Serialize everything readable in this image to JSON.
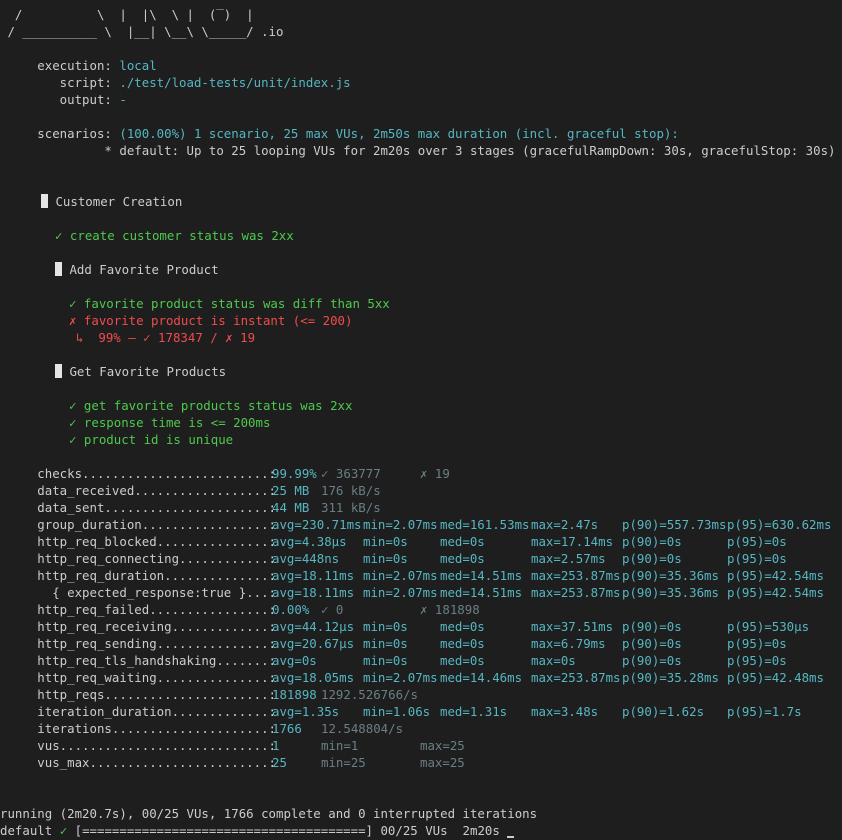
{
  "logo": {
    "line1": "  /          \\  |  |\\  \\ |  (‾)  |",
    "line2": " / __________ \\  |__| \\__\\ \\_____/ .io"
  },
  "options": [
    {
      "label": "     execution: ",
      "value": "local"
    },
    {
      "label": "        script: ",
      "value": "./test/load-tests/unit/index.js"
    },
    {
      "label": "        output: ",
      "value": "-"
    }
  ],
  "scenarios": {
    "label": "     scenarios: ",
    "summary": "(100.00%) 1 scenario, 25 max VUs, 2m50s max duration (incl. graceful stop):",
    "detail": "              * default: Up to 25 looping VUs for 2m20s over 3 stages (gracefulRampDown: 30s, gracefulStop: 30s)"
  },
  "groups": {
    "customer_creation": "Customer Creation",
    "add_favorite": "Add Favorite Product",
    "get_favorites": "Get Favorite Products"
  },
  "checks_list": {
    "create_status": "✓ create customer status was 2xx",
    "fav_status": "✓ favorite product status was diff than 5xx",
    "fav_instant": "✗ favorite product is instant (<= 200)",
    "fav_instant_detail": "↳  99% — ✓ 178347 / ✗ 19",
    "get_status": "✓ get favorite products status was 2xx",
    "response_time": "✓ response time is <= 200ms",
    "product_id": "✓ product id is unique"
  },
  "metrics": [
    {
      "name": "     checks.........................: ",
      "cols": [
        {
          "t": "99.99%",
          "k": "c"
        },
        {
          "t": "✓ 363777",
          "k": "dim"
        },
        {
          "t": "✗ 19",
          "k": "dim"
        }
      ]
    },
    {
      "name": "     data_received..................: ",
      "cols": [
        {
          "t": "25 MB",
          "k": "c"
        },
        {
          "t": "176 kB/s",
          "k": "dim"
        }
      ]
    },
    {
      "name": "     data_sent......................: ",
      "cols": [
        {
          "t": "44 MB",
          "k": "c"
        },
        {
          "t": "311 kB/s",
          "k": "dim"
        }
      ]
    },
    {
      "name": "     group_duration.................: ",
      "cols": [
        {
          "t": "avg=230.71ms",
          "k": "c"
        },
        {
          "t": "min=2.07ms",
          "k": "c"
        },
        {
          "t": "med=161.53ms",
          "k": "c"
        },
        {
          "t": "max=2.47s",
          "k": "c"
        },
        {
          "t": "p(90)=557.73ms",
          "k": "c"
        },
        {
          "t": "p(95)=630.62ms",
          "k": "c"
        }
      ]
    },
    {
      "name": "     http_req_blocked...............: ",
      "cols": [
        {
          "t": "avg=4.38µs",
          "k": "c"
        },
        {
          "t": "min=0s",
          "k": "c"
        },
        {
          "t": "med=0s",
          "k": "c"
        },
        {
          "t": "max=17.14ms",
          "k": "c"
        },
        {
          "t": "p(90)=0s",
          "k": "c"
        },
        {
          "t": "p(95)=0s",
          "k": "c"
        }
      ]
    },
    {
      "name": "     http_req_connecting............: ",
      "cols": [
        {
          "t": "avg=448ns",
          "k": "c"
        },
        {
          "t": "min=0s",
          "k": "c"
        },
        {
          "t": "med=0s",
          "k": "c"
        },
        {
          "t": "max=2.57ms",
          "k": "c"
        },
        {
          "t": "p(90)=0s",
          "k": "c"
        },
        {
          "t": "p(95)=0s",
          "k": "c"
        }
      ]
    },
    {
      "name": "     http_req_duration..............: ",
      "cols": [
        {
          "t": "avg=18.11ms",
          "k": "c"
        },
        {
          "t": "min=2.07ms",
          "k": "c"
        },
        {
          "t": "med=14.51ms",
          "k": "c"
        },
        {
          "t": "max=253.87ms",
          "k": "c"
        },
        {
          "t": "p(90)=35.36ms",
          "k": "c"
        },
        {
          "t": "p(95)=42.54ms",
          "k": "c"
        }
      ]
    },
    {
      "name": "       { expected_response:true }...: ",
      "cols": [
        {
          "t": "avg=18.11ms",
          "k": "c"
        },
        {
          "t": "min=2.07ms",
          "k": "c"
        },
        {
          "t": "med=14.51ms",
          "k": "c"
        },
        {
          "t": "max=253.87ms",
          "k": "c"
        },
        {
          "t": "p(90)=35.36ms",
          "k": "c"
        },
        {
          "t": "p(95)=42.54ms",
          "k": "c"
        }
      ]
    },
    {
      "name": "     http_req_failed................: ",
      "cols": [
        {
          "t": "0.00%",
          "k": "c"
        },
        {
          "t": "✓ 0",
          "k": "dim"
        },
        {
          "t": "✗ 181898",
          "k": "dim"
        }
      ]
    },
    {
      "name": "     http_req_receiving.............: ",
      "cols": [
        {
          "t": "avg=44.12µs",
          "k": "c"
        },
        {
          "t": "min=0s",
          "k": "c"
        },
        {
          "t": "med=0s",
          "k": "c"
        },
        {
          "t": "max=37.51ms",
          "k": "c"
        },
        {
          "t": "p(90)=0s",
          "k": "c"
        },
        {
          "t": "p(95)=530µs",
          "k": "c"
        }
      ]
    },
    {
      "name": "     http_req_sending...............: ",
      "cols": [
        {
          "t": "avg=20.67µs",
          "k": "c"
        },
        {
          "t": "min=0s",
          "k": "c"
        },
        {
          "t": "med=0s",
          "k": "c"
        },
        {
          "t": "max=6.79ms",
          "k": "c"
        },
        {
          "t": "p(90)=0s",
          "k": "c"
        },
        {
          "t": "p(95)=0s",
          "k": "c"
        }
      ]
    },
    {
      "name": "     http_req_tls_handshaking.......: ",
      "cols": [
        {
          "t": "avg=0s",
          "k": "c"
        },
        {
          "t": "min=0s",
          "k": "c"
        },
        {
          "t": "med=0s",
          "k": "c"
        },
        {
          "t": "max=0s",
          "k": "c"
        },
        {
          "t": "p(90)=0s",
          "k": "c"
        },
        {
          "t": "p(95)=0s",
          "k": "c"
        }
      ]
    },
    {
      "name": "     http_req_waiting...............: ",
      "cols": [
        {
          "t": "avg=18.05ms",
          "k": "c"
        },
        {
          "t": "min=2.07ms",
          "k": "c"
        },
        {
          "t": "med=14.46ms",
          "k": "c"
        },
        {
          "t": "max=253.87ms",
          "k": "c"
        },
        {
          "t": "p(90)=35.28ms",
          "k": "c"
        },
        {
          "t": "p(95)=42.48ms",
          "k": "c"
        }
      ]
    },
    {
      "name": "     http_reqs......................: ",
      "cols": [
        {
          "t": "181898",
          "k": "c"
        },
        {
          "t": "1292.526766/s",
          "k": "dim"
        }
      ]
    },
    {
      "name": "     iteration_duration.............: ",
      "cols": [
        {
          "t": "avg=1.35s",
          "k": "c"
        },
        {
          "t": "min=1.06s",
          "k": "c"
        },
        {
          "t": "med=1.31s",
          "k": "c"
        },
        {
          "t": "max=3.48s",
          "k": "c"
        },
        {
          "t": "p(90)=1.62s",
          "k": "c"
        },
        {
          "t": "p(95)=1.7s",
          "k": "c"
        }
      ]
    },
    {
      "name": "     iterations.....................: ",
      "cols": [
        {
          "t": "1766",
          "k": "c"
        },
        {
          "t": "12.548804/s",
          "k": "dim"
        }
      ]
    },
    {
      "name": "     vus............................: ",
      "cols": [
        {
          "t": "1",
          "k": "c"
        },
        {
          "t": "min=1",
          "k": "dim"
        },
        {
          "t": "max=25",
          "k": "dim"
        }
      ]
    },
    {
      "name": "     vus_max........................: ",
      "cols": [
        {
          "t": "25",
          "k": "c"
        },
        {
          "t": "min=25",
          "k": "dim"
        },
        {
          "t": "max=25",
          "k": "dim"
        }
      ]
    }
  ],
  "footer": {
    "running": "running (2m20.7s), 00/25 VUs, 1766 complete and 0 interrupted iterations",
    "default_label": "default ",
    "check": "✓",
    "progress": " [======================================] ",
    "vus": "00/25 VUs",
    "elapsed": "  2m20s",
    "progress_fraction": 1.0
  }
}
